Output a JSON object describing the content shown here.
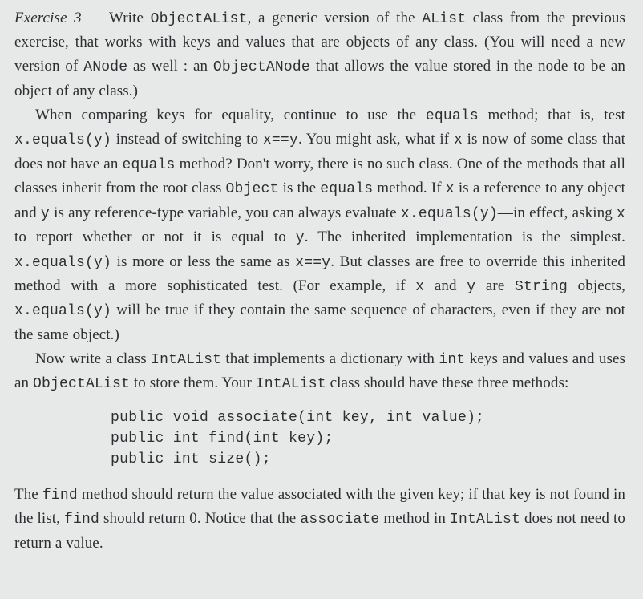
{
  "exercise": {
    "label": "Exercise 3",
    "p1_a": "Write ",
    "p1_c1": "ObjectAList",
    "p1_b": ", a generic version of the ",
    "p1_c2": "AList",
    "p1_c": " class from the previous exercise, that works with keys and values that are objects of any class. (You will need a new version of ",
    "p1_c3": "ANode",
    "p1_d": " as well : an ",
    "p1_c4": "ObjectANode",
    "p1_e": " that allows the value stored in the node to be an object of any class.)",
    "p2_a": "When comparing keys for equality, continue to use the ",
    "p2_c1": "equals",
    "p2_b": " method; that is, test ",
    "p2_c2": "x.equals(y)",
    "p2_c": " instead of switching to ",
    "p2_c3": "x==y",
    "p2_d": ". You might ask, what if ",
    "p2_c4": "x",
    "p2_e": " is now of some class that does not have an ",
    "p2_c5": "equals",
    "p2_f": " method? Don't worry, there is no such class. One of the methods that all classes inherit from the root class ",
    "p2_c6": "Object",
    "p2_g": " is the ",
    "p2_c7": "equals",
    "p2_h": " method. If ",
    "p2_c8": "x",
    "p2_i": " is a reference to any object and ",
    "p2_c9": "y",
    "p2_j": " is any reference-type variable, you can always evaluate ",
    "p2_c10": "x.equals(y)",
    "p2_k": "—in effect, asking ",
    "p2_c11": "x",
    "p2_l": " to report whether or not it is equal to ",
    "p2_c12": "y",
    "p2_m": ". The inherited implementation is the simplest. ",
    "p2_c13": "x.equals(y)",
    "p2_n": " is more or less the same as ",
    "p2_c14": "x==y",
    "p2_o": ". But classes are free to override this inherited method with a more sophisticated test. (For example, if ",
    "p2_c15": "x",
    "p2_p": " and ",
    "p2_c16": "y",
    "p2_q": " are ",
    "p2_c17": "String",
    "p2_r": " objects, ",
    "p2_c18": "x.equals(y)",
    "p2_s": " will be true if they contain the same sequence of characters, even if they are not the same object.)",
    "p3_a": "Now write a class ",
    "p3_c1": "IntAList",
    "p3_b": " that implements a dictionary with ",
    "p3_c2": "int",
    "p3_c": " keys and values and uses an ",
    "p3_c3": "ObjectAList",
    "p3_d": " to store them. Your ",
    "p3_c4": "IntAList",
    "p3_e": " class should have these three methods:",
    "code_block": "public void associate(int key, int value);\npublic int find(int key);\npublic int size();",
    "p4_a": "The ",
    "p4_c1": "find",
    "p4_b": " method should return the value associated with the given key; if that key is not found in the list, ",
    "p4_c2": "find",
    "p4_c": " should return 0. Notice that the ",
    "p4_c3": "associate",
    "p4_d": " method in ",
    "p4_c4": "IntAList",
    "p4_e": " does not need to return a value."
  }
}
